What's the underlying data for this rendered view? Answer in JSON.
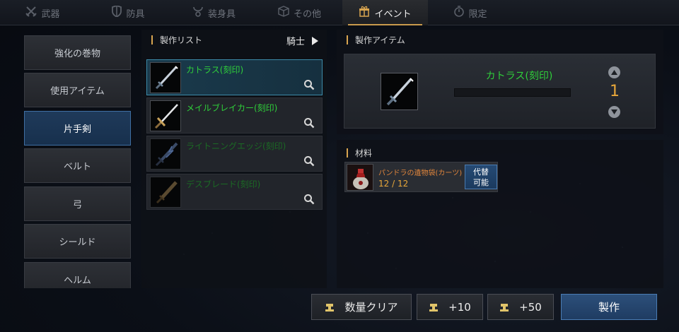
{
  "tabs": [
    {
      "label": "武器",
      "icon": "crossed-swords-icon",
      "active": false
    },
    {
      "label": "防具",
      "icon": "shield-icon",
      "active": false
    },
    {
      "label": "装身具",
      "icon": "necklace-icon",
      "active": false
    },
    {
      "label": "その他",
      "icon": "box-icon",
      "active": false
    },
    {
      "label": "イベント",
      "icon": "gift-icon",
      "active": true
    },
    {
      "label": "限定",
      "icon": "timer-icon",
      "active": false
    }
  ],
  "categories": [
    "強化の巻物",
    "使用アイテム",
    "片手剣",
    "ベルト",
    "弓",
    "シールド",
    "ヘルム"
  ],
  "selected_category": "片手剣",
  "craft_list": {
    "title": "製作リスト",
    "class_filter": "騎士",
    "items": [
      {
        "name": "カトラス(刻印)",
        "selected": true,
        "locked": false
      },
      {
        "name": "メイルブレイカー(刻印)",
        "selected": false,
        "locked": false
      },
      {
        "name": "ライトニングエッジ(刻印)",
        "selected": false,
        "locked": true
      },
      {
        "name": "デスブレード(刻印)",
        "selected": false,
        "locked": true
      }
    ]
  },
  "craft_item": {
    "title": "製作アイテム",
    "name": "カトラス(刻印)",
    "quantity": "1"
  },
  "materials": {
    "title": "材料",
    "items": [
      {
        "name": "パンドラの遺物袋(カーツ)",
        "count": "12 / 12",
        "substitute_line1": "代替",
        "substitute_line2": "可能"
      }
    ]
  },
  "buttons": {
    "clear": "数量クリア",
    "plus10": "+10",
    "plus50": "+50",
    "craft": "製作"
  },
  "colors": {
    "accent": "#d9a550",
    "item_green": "#2fcf3a",
    "quantity": "#e8a73a",
    "selected_blue": "#3f6fa3"
  }
}
